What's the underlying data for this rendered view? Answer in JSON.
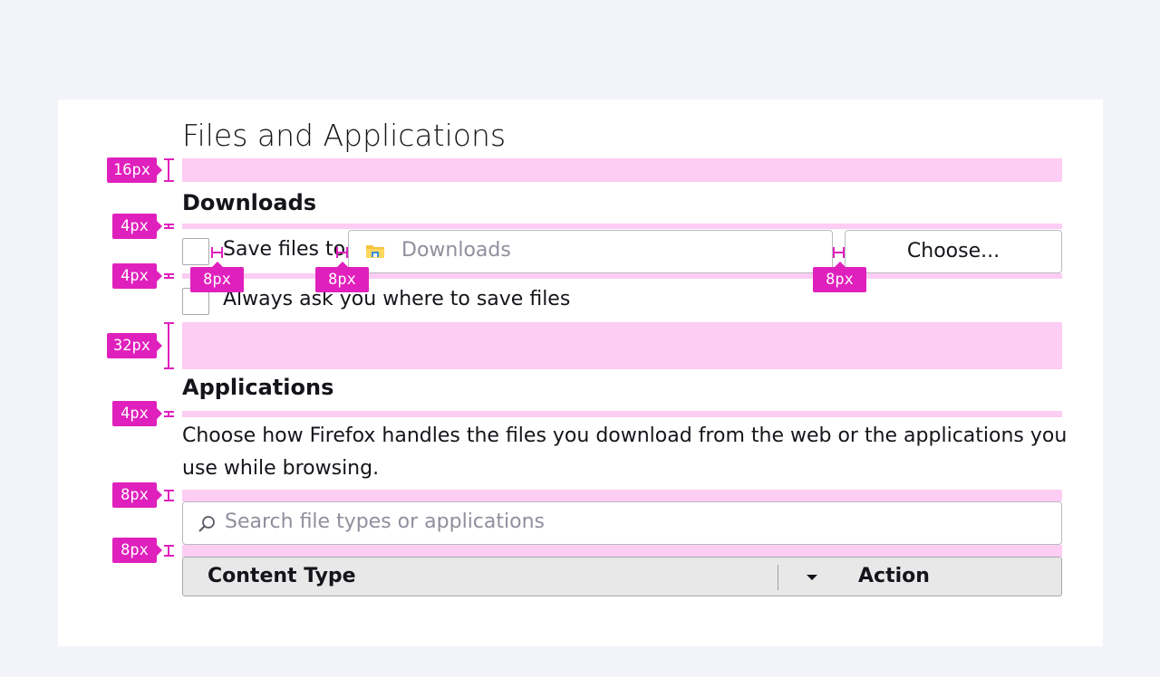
{
  "page": {
    "title": "Files and Applications"
  },
  "downloads": {
    "heading": "Downloads",
    "save_files_label": "Save files to",
    "folder_value": "Downloads",
    "choose_button": "Choose...",
    "always_ask_label": "Always ask you where to save files"
  },
  "applications": {
    "heading": "Applications",
    "description_line1": "Choose how Firefox handles the files you download from the web or the applications you",
    "description_line2": "use while browsing.",
    "search_placeholder": "Search file types or applications",
    "table_columns": [
      "Content Type",
      "Action"
    ]
  },
  "annotations": {
    "spacing_tags": [
      "16px",
      "4px",
      "4px",
      "32px",
      "4px",
      "8px",
      "8px"
    ],
    "gap_tags": [
      "8px",
      "8px",
      "8px"
    ]
  },
  "colors": {
    "page_background": "#f3f4f9",
    "panel_background": "#ffffff",
    "spacing_band": "#fdcdf4",
    "annotation": "#e020bd",
    "table_header": "#e8e8e8"
  },
  "icons": {
    "folder": "folder-icon",
    "search": "search-icon",
    "sort": "sort-down-icon"
  }
}
